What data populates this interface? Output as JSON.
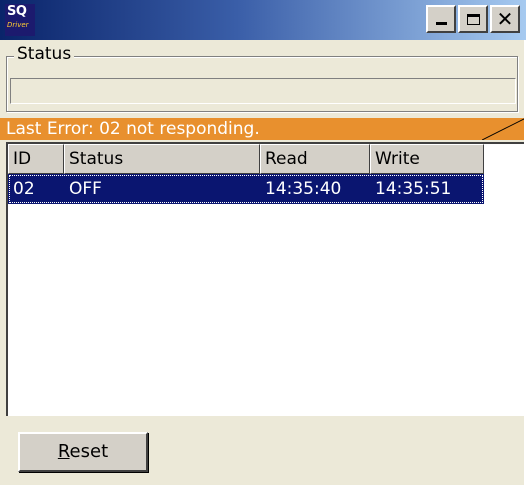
{
  "titlebar": {
    "icon": {
      "name": "sq-driver-app-icon",
      "line1": "SQ",
      "line2": "Driver"
    },
    "buttons": [
      "minimize-icon",
      "maximize-icon",
      "close-icon"
    ],
    "close_glyph": "✕"
  },
  "status_group": {
    "label": "Status",
    "value": ""
  },
  "error": {
    "text": "Last Error: 02 not responding.",
    "color": "#e8902e"
  },
  "table": {
    "columns": [
      "ID",
      "Status",
      "Read",
      "Write"
    ],
    "rows": [
      {
        "id": "02",
        "status": "OFF",
        "read": "14:35:40",
        "write": "14:35:51",
        "selected": true
      }
    ],
    "selection_color": "#0a1570"
  },
  "reset_button": {
    "accel": "R",
    "rest": "eset"
  },
  "colors": {
    "titlebar_start": "#0a246a",
    "window_bg": "#ece9d8"
  }
}
